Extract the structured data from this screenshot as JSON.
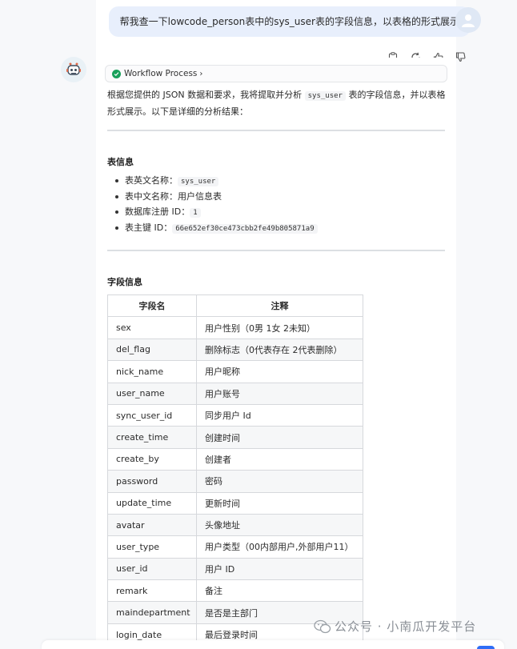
{
  "user_message": "帮我查一下lowcode_person表中的sys_user表的字段信息，以表格的形式展示",
  "workflow": {
    "label": "Workflow Process"
  },
  "intro": {
    "part1": "根据您提供的 JSON 数据和要求，我将提取并分析",
    "code": "sys_user",
    "part2": "表的字段信息，并以表格形式展示。以下是详细的分析结果："
  },
  "table_info": {
    "title": "表信息",
    "items": [
      {
        "label": "表英文名称：",
        "value": "sys_user",
        "is_code": true
      },
      {
        "label": "表中文名称：",
        "value": "用户信息表",
        "is_code": false
      },
      {
        "label": "数据库注册 ID：",
        "value": "1",
        "is_code": true
      },
      {
        "label": "表主键 ID：",
        "value": "66e652ef30ce473cbb2fe49b805871a9",
        "is_code": true
      }
    ]
  },
  "fields": {
    "title": "字段信息",
    "headers": [
      "字段名",
      "注释"
    ],
    "rows": [
      [
        "sex",
        "用户性别（0男 1女 2未知）"
      ],
      [
        "del_flag",
        "删除标志（0代表存在 2代表删除）"
      ],
      [
        "nick_name",
        "用户昵称"
      ],
      [
        "user_name",
        "用户账号"
      ],
      [
        "sync_user_id",
        "同步用户 Id"
      ],
      [
        "create_time",
        "创建时间"
      ],
      [
        "create_by",
        "创建者"
      ],
      [
        "password",
        "密码"
      ],
      [
        "update_time",
        "更新时间"
      ],
      [
        "avatar",
        "头像地址"
      ],
      [
        "user_type",
        "用户类型（00内部用户,外部用户11）"
      ],
      [
        "user_id",
        "用户 ID"
      ],
      [
        "remark",
        "备注"
      ],
      [
        "maindepartment",
        "是否是主部门"
      ],
      [
        "login_date",
        "最后登录时间"
      ]
    ]
  },
  "watermark": "公众号 · 小南瓜开发平台",
  "icons": {
    "actions": [
      "clipboard-icon",
      "refresh-icon",
      "thumbs-up-icon",
      "thumbs-down-icon"
    ]
  },
  "colors": {
    "user_bubble": "#e8effc",
    "check": "#19a15b",
    "send": "#2f6df6"
  }
}
